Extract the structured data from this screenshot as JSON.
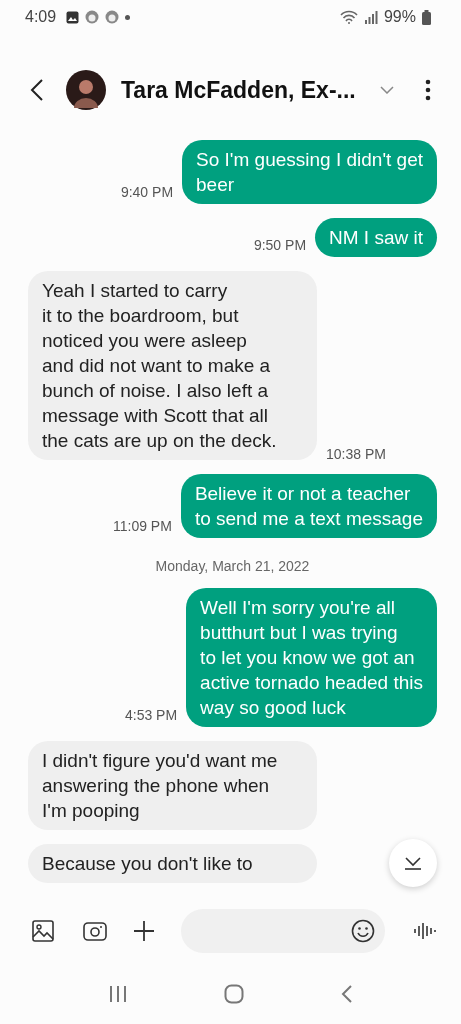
{
  "status_bar": {
    "time": "4:09",
    "battery": "99%"
  },
  "header": {
    "title": "Tara McFadden, Ex-..."
  },
  "messages": [
    {
      "kind": "sent",
      "text": "So I'm guessing I didn't get\nbeer",
      "time": "9:40 PM"
    },
    {
      "kind": "sent",
      "text": "NM I saw it",
      "time": "9:50 PM"
    },
    {
      "kind": "received",
      "text": "Yeah I started to carry\nit to the boardroom, but\nnoticed you were asleep\nand did not want to make a\nbunch of noise. I also left a\nmessage with Scott that all\nthe cats are up on the deck.",
      "time": "10:38 PM"
    },
    {
      "kind": "sent",
      "text": "Believe it or not a teacher\nto send me a text message",
      "time": "11:09 PM"
    },
    {
      "kind": "date",
      "text": "Monday, March 21, 2022"
    },
    {
      "kind": "sent",
      "text": "Well I'm sorry you're all\nbutthurt but I was trying\nto let you know we got an\nactive tornado headed this\nway so good luck",
      "time": "4:53 PM"
    },
    {
      "kind": "received",
      "text": "I didn't figure you'd want me\nanswering the phone when\nI'm pooping"
    },
    {
      "kind": "received",
      "text": "Because you don't like to"
    }
  ]
}
